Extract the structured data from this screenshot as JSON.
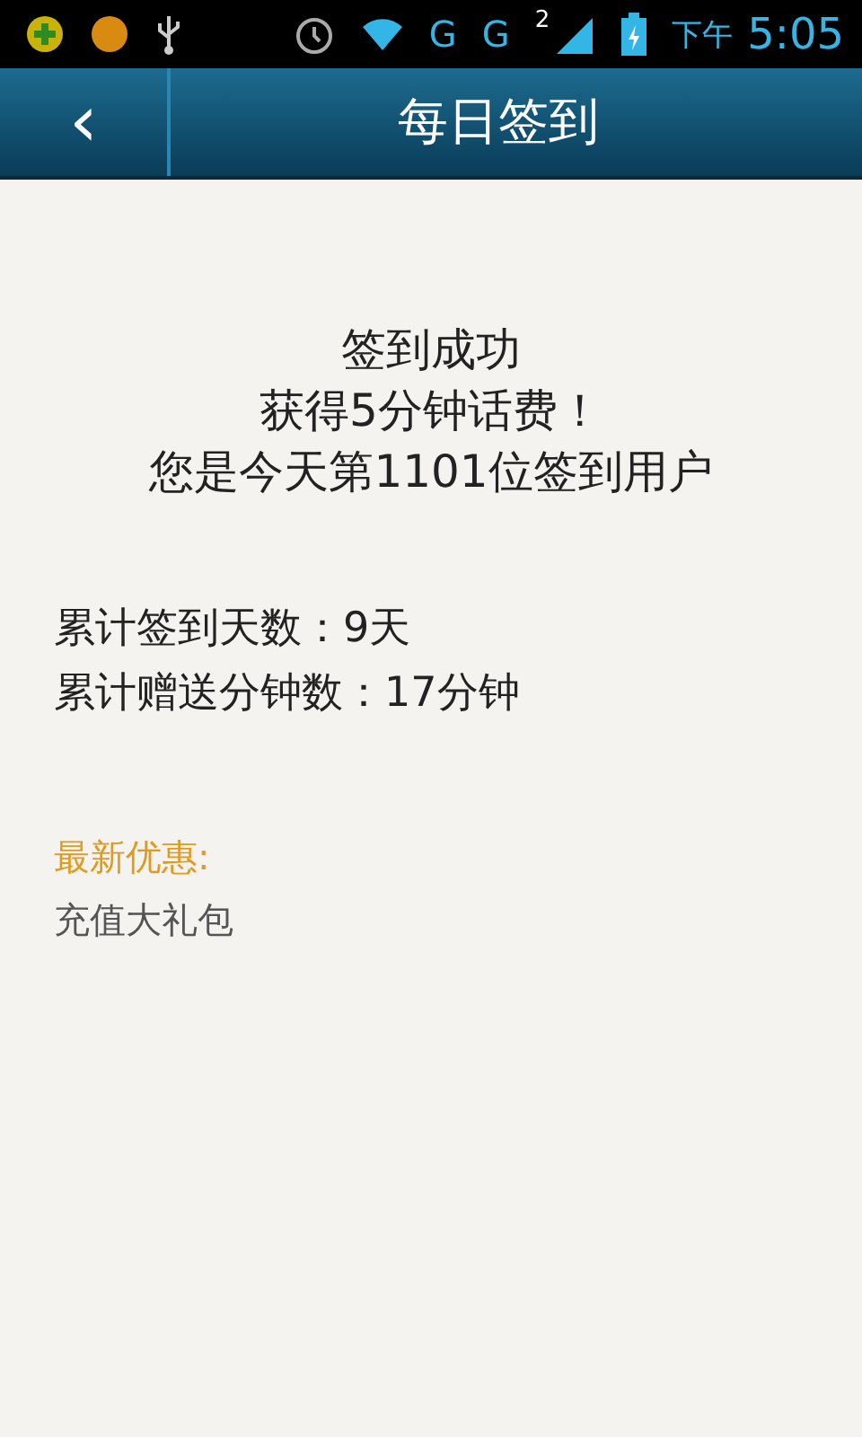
{
  "status_bar": {
    "network_labels": [
      "G",
      "G"
    ],
    "sim_number": "2",
    "period": "下午",
    "time": "5:05"
  },
  "header": {
    "back": "‹",
    "title": "每日签到"
  },
  "result": {
    "lines": [
      "签到成功",
      "获得5分钟话费！",
      "您是今天第1101位签到用户"
    ]
  },
  "stats": [
    "累计签到天数：9天",
    "累计赠送分钟数：17分钟"
  ],
  "promo": {
    "heading": "最新优惠:",
    "item": "充值大礼包"
  }
}
